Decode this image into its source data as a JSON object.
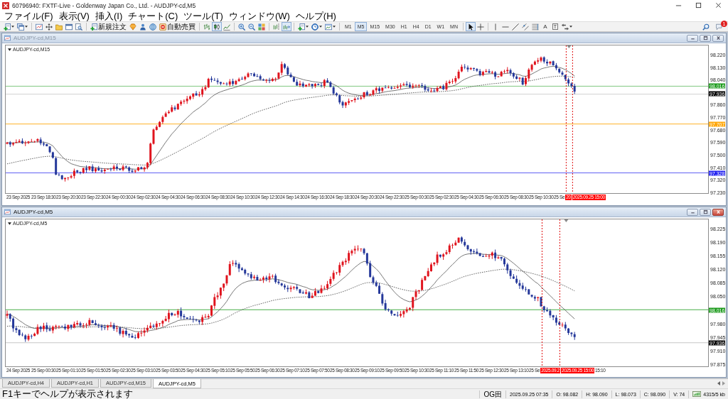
{
  "window": {
    "title": "60796940: FXTF-Live - Goldenway Japan Co., Ltd. - AUDJPY-cd,M5"
  },
  "menu": [
    "ファイル(F)",
    "表示(V)",
    "挿入(I)",
    "チャート(C)",
    "ツール(T)",
    "ウィンドウ(W)",
    "ヘルプ(H)"
  ],
  "toolbar": {
    "groups": [
      [
        {
          "kind": "new-chart",
          "dropdown": true
        },
        {
          "kind": "profiles",
          "dropdown": true
        }
      ],
      [
        {
          "kind": "chart-window"
        },
        {
          "kind": "move-arrows"
        },
        {
          "kind": "folders"
        },
        {
          "kind": "window"
        },
        {
          "kind": "document-search"
        }
      ],
      [
        {
          "kind": "order",
          "label": "新規注文"
        },
        {
          "kind": "gem"
        },
        {
          "kind": "person"
        },
        {
          "kind": "globe"
        },
        {
          "kind": "auto-trading",
          "label": "自動売買"
        }
      ],
      [
        {
          "kind": "ohlc-bars",
          "selected": false
        },
        {
          "kind": "candlesticks",
          "selected": true
        },
        {
          "kind": "line-chart",
          "selected": false
        }
      ],
      [
        {
          "kind": "zoom-in"
        },
        {
          "kind": "zoom-out"
        },
        {
          "kind": "tile-windows"
        }
      ],
      [
        {
          "kind": "chart-shift",
          "selected": false
        },
        {
          "kind": "auto-scroll",
          "selected": true
        }
      ],
      [
        {
          "kind": "indicators",
          "dropdown": true
        },
        {
          "kind": "periods",
          "dropdown": true
        },
        {
          "kind": "templates",
          "dropdown": true
        }
      ],
      [
        {
          "kind": "timeframe",
          "label": "M1",
          "selected": false
        },
        {
          "kind": "timeframe",
          "label": "M5",
          "selected": true
        },
        {
          "kind": "timeframe",
          "label": "M15",
          "selected": false
        },
        {
          "kind": "timeframe",
          "label": "M30",
          "selected": false
        },
        {
          "kind": "timeframe",
          "label": "H1",
          "selected": false
        },
        {
          "kind": "timeframe",
          "label": "H4",
          "selected": false
        },
        {
          "kind": "timeframe",
          "label": "D1",
          "selected": false
        },
        {
          "kind": "timeframe",
          "label": "W1",
          "selected": false
        },
        {
          "kind": "timeframe",
          "label": "MN",
          "selected": false
        }
      ],
      [
        {
          "kind": "cursor",
          "selected": true
        },
        {
          "kind": "crosshair",
          "selected": false
        }
      ],
      [
        {
          "kind": "vertical-line"
        },
        {
          "kind": "horizontal-line"
        },
        {
          "kind": "trend-line"
        },
        {
          "kind": "channel"
        },
        {
          "kind": "fibonacci"
        },
        {
          "kind": "text-tool",
          "label": "A"
        },
        {
          "kind": "text-label-tool",
          "label": "T"
        },
        {
          "kind": "arrows",
          "dropdown": true
        }
      ]
    ],
    "notification_count": "1"
  },
  "charts": [
    {
      "title": "AUDJPY-cd,M15",
      "active": false,
      "symbol_label": "AUDJPY-cd,M15",
      "price_axis": [
        "98.220",
        "98.130",
        "98.040",
        "97.860",
        "97.770",
        "97.680",
        "97.590",
        "97.500",
        "97.410",
        "97.320",
        "97.230"
      ],
      "price_tags": [
        {
          "text": "98.016",
          "color": "#1a9a1a"
        },
        {
          "text": "97.936",
          "color": "#000000"
        },
        {
          "text": "97.707",
          "color": "#ffa500"
        },
        {
          "text": "97.328",
          "color": "#2020f0"
        }
      ],
      "time_axis": [
        {
          "kind": "tick",
          "text": "23 Sep 2025"
        },
        {
          "kind": "tick",
          "text": "23 Sep 18:30"
        },
        {
          "kind": "tick",
          "text": "23 Sep 20:30"
        },
        {
          "kind": "tick",
          "text": "23 Sep 22:30"
        },
        {
          "kind": "tick",
          "text": "24 Sep 00:30"
        },
        {
          "kind": "tick",
          "text": "24 Sep 02:30"
        },
        {
          "kind": "tick",
          "text": "24 Sep 04:30"
        },
        {
          "kind": "tick",
          "text": "24 Sep 06:30"
        },
        {
          "kind": "tick",
          "text": "24 Sep 08:30"
        },
        {
          "kind": "tick",
          "text": "24 Sep 10:30"
        },
        {
          "kind": "tick",
          "text": "24 Sep 12:30"
        },
        {
          "kind": "tick",
          "text": "24 Sep 14:30"
        },
        {
          "kind": "tick",
          "text": "24 Sep 16:30"
        },
        {
          "kind": "tick",
          "text": "24 Sep 18:30"
        },
        {
          "kind": "tick",
          "text": "24 Sep 20:30"
        },
        {
          "kind": "tick",
          "text": "24 Sep 22:30"
        },
        {
          "kind": "tick",
          "text": "25 Sep 00:30"
        },
        {
          "kind": "tick",
          "text": "25 Sep 02:30"
        },
        {
          "kind": "tick",
          "text": "25 Sep 04:30"
        },
        {
          "kind": "tick",
          "text": "25 Sep 06:30"
        },
        {
          "kind": "tick",
          "text": "25 Sep 08:30"
        },
        {
          "kind": "tick",
          "text": "25 Sep 10:30"
        },
        {
          "kind": "tick",
          "text": "25 Se"
        },
        {
          "kind": "cursor",
          "text": "20"
        },
        {
          "kind": "cursor",
          "text": "2025.09.25 15:00"
        }
      ]
    },
    {
      "title": "AUDJPY-cd,M5",
      "active": true,
      "symbol_label": "AUDJPY-cd,M5",
      "price_axis": [
        "98.225",
        "98.190",
        "98.155",
        "98.120",
        "98.085",
        "98.050",
        "97.980",
        "97.945",
        "97.910",
        "97.875"
      ],
      "price_tags": [
        {
          "text": "98.016",
          "color": "#1a9a1a"
        },
        {
          "text": "97.936",
          "color": "#000000"
        }
      ],
      "time_axis": [
        {
          "kind": "tick",
          "text": "24 Sep 2025"
        },
        {
          "kind": "tick",
          "text": "25 Sep 00:30"
        },
        {
          "kind": "tick",
          "text": "25 Sep 01:10"
        },
        {
          "kind": "tick",
          "text": "25 Sep 01:50"
        },
        {
          "kind": "tick",
          "text": "25 Sep 02:30"
        },
        {
          "kind": "tick",
          "text": "25 Sep 03:10"
        },
        {
          "kind": "tick",
          "text": "25 Sep 03:50"
        },
        {
          "kind": "tick",
          "text": "25 Sep 04:30"
        },
        {
          "kind": "tick",
          "text": "25 Sep 05:10"
        },
        {
          "kind": "tick",
          "text": "25 Sep 05:50"
        },
        {
          "kind": "tick",
          "text": "25 Sep 06:30"
        },
        {
          "kind": "tick",
          "text": "25 Sep 07:10"
        },
        {
          "kind": "tick",
          "text": "25 Sep 07:50"
        },
        {
          "kind": "tick",
          "text": "25 Sep 08:30"
        },
        {
          "kind": "tick",
          "text": "25 Sep 09:10"
        },
        {
          "kind": "tick",
          "text": "25 Sep 09:50"
        },
        {
          "kind": "tick",
          "text": "25 Sep 10:30"
        },
        {
          "kind": "tick",
          "text": "25 Sep 11:10"
        },
        {
          "kind": "tick",
          "text": "25 Sep 11:50"
        },
        {
          "kind": "tick",
          "text": "25 Sep 12:30"
        },
        {
          "kind": "tick",
          "text": "25 Sep 13:10"
        },
        {
          "kind": "tick",
          "text": "25 Se"
        },
        {
          "kind": "cursor",
          "text": "2025.09.2"
        },
        {
          "kind": "cursor",
          "text": "2025.09.25 15:00"
        },
        {
          "kind": "tick",
          "text": "15:10"
        }
      ]
    }
  ],
  "tabs": [
    {
      "label": "AUDJPY-cd,H4",
      "selected": false
    },
    {
      "label": "AUDJPY-cd,H1",
      "selected": false
    },
    {
      "label": "AUDJPY-cd,M15",
      "selected": false
    },
    {
      "label": "AUDJPY-cd,M5",
      "selected": true
    }
  ],
  "status_bar": {
    "help": "F1キーでヘルプが表示されます",
    "profile": "OG田",
    "datetime": "2025.09.25 07:35",
    "open": "O: 98.082",
    "high": "H: 98.090",
    "low": "L: 98.073",
    "close": "C: 98.090",
    "volume": "V: 74",
    "traffic": "4315/5 kb"
  }
}
